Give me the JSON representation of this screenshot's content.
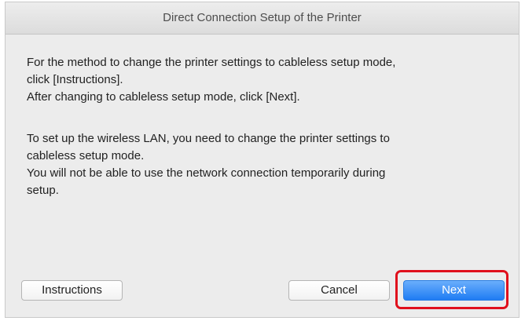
{
  "window": {
    "title": "Direct Connection Setup of the Printer"
  },
  "content": {
    "paragraph1": [
      "For the method to change the printer settings to cableless setup mode,",
      "click [Instructions].",
      "After changing to cableless setup mode, click [Next]."
    ],
    "paragraph2": [
      "To set up the wireless LAN, you need to change the printer settings to",
      "cableless setup mode.",
      "You will not be able to use the network connection temporarily during",
      "setup."
    ]
  },
  "buttons": {
    "instructions": "Instructions",
    "cancel": "Cancel",
    "next": "Next"
  },
  "colors": {
    "highlight_border": "#e0101c",
    "default_button": "#1f7cf3"
  }
}
